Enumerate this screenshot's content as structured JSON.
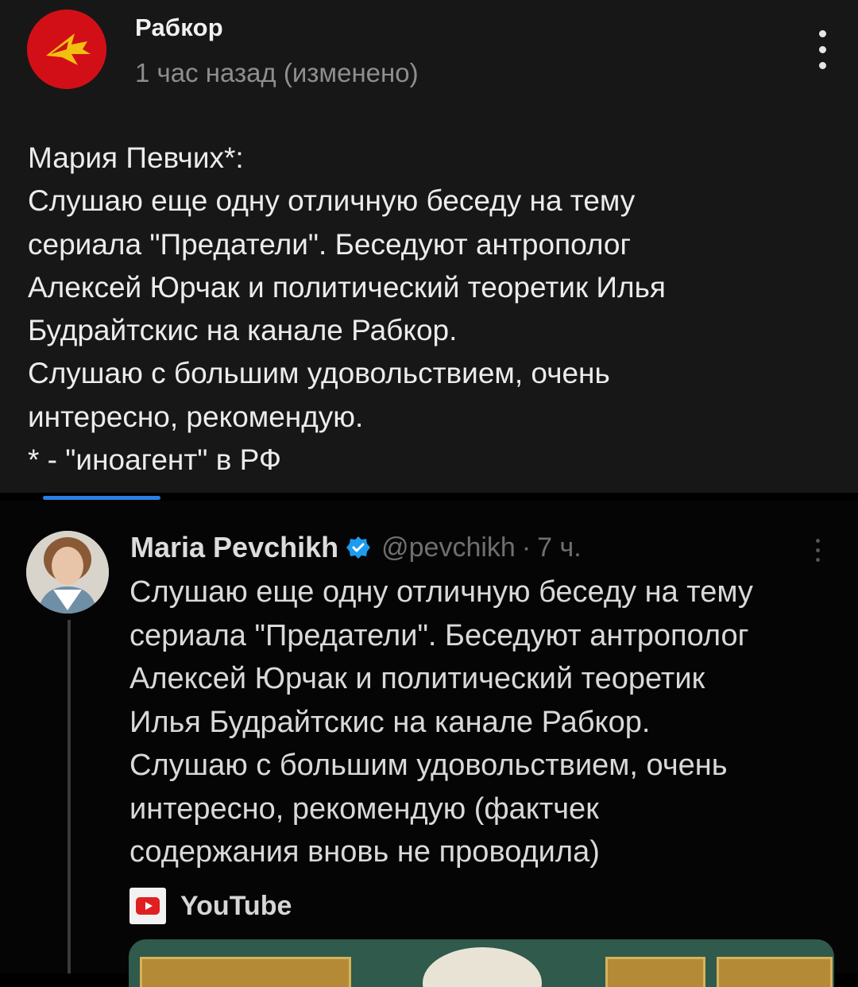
{
  "post": {
    "channel_name": "Рабкор",
    "timestamp": "1 час назад (изменено)",
    "more_icon": "more-vertical-icon",
    "text_lines": [
      "Мария Певчих*:",
      "Слушаю еще одну отличную беседу на тему",
      "сериала \"Предатели\". Беседуют антрополог",
      "Алексей Юрчак и политический теоретик Илья",
      "Будрайтскис на канале Рабкор.",
      "Слушаю с большим удовольствием, очень",
      "интересно, рекомендую.",
      "* - \"иноагент\" в РФ"
    ]
  },
  "tweet": {
    "author": "Maria Pevchikh",
    "verified_icon": "verified-badge-icon",
    "handle": "@pevchikh",
    "separator": "·",
    "time": "7 ч.",
    "text_lines": [
      "Слушаю еще одну отличную беседу на тему",
      "сериала \"Предатели\". Беседуют антрополог",
      "Алексей Юрчак и политический теоретик",
      "Илья Будрайтскис на канале Рабкор.",
      "Слушаю с большим удовольствием, очень",
      "интересно, рекомендую (фактчек",
      "содержания вновь не проводила)"
    ],
    "link_source": "YouTube"
  },
  "colors": {
    "page_bg": "#000000",
    "post_bg": "#171717",
    "accent_blue": "#2a7fe6",
    "channel_red": "#d20f16",
    "channel_yellow": "#f2c00f",
    "verified_blue": "#1d9bf0",
    "youtube_red": "#e02020"
  }
}
